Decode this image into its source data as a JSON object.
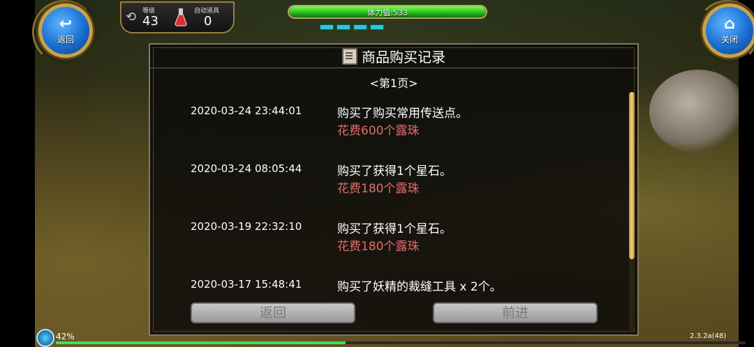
{
  "hud": {
    "back_label": "返回",
    "close_label": "关闭",
    "level_caption": "等级",
    "level_value": "43",
    "auto_item_caption": "自动道具",
    "auto_item_value": "0",
    "stamina_text": "体力值:533",
    "stamina_fraction": 1.0,
    "pips_count": 4
  },
  "panel": {
    "title": "商品购买记录",
    "page_label": "<第1页>",
    "records": [
      {
        "time": "2020-03-24 23:44:01",
        "desc": "购买了购买常用传送点。",
        "cost": "花费600个露珠"
      },
      {
        "time": "2020-03-24 08:05:44",
        "desc": "购买了获得1个星石。",
        "cost": "花费180个露珠"
      },
      {
        "time": "2020-03-19 22:32:10",
        "desc": "购买了获得1个星石。",
        "cost": "花费180个露珠"
      },
      {
        "time": "2020-03-17 15:48:41",
        "desc": "购买了妖精的裁缝工具 x 2个。",
        "cost": ""
      }
    ],
    "back_button": "返回",
    "next_button": "前进"
  },
  "footer": {
    "loading_percent": "42%",
    "loading_fraction": 0.42,
    "version": "2.3.2a(48)"
  },
  "colors": {
    "cost_text": "#e36b6b",
    "stamina_green": "#24b81a",
    "round_button_blue": "#1a6fd1"
  }
}
